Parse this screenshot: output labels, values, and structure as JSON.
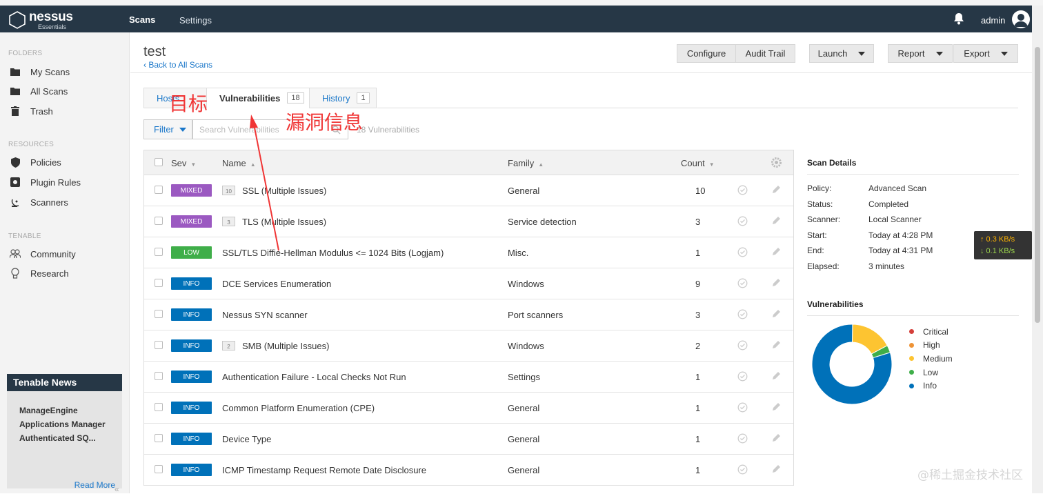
{
  "header": {
    "logo_name": "nessus",
    "logo_sub": "Essentials",
    "nav_scans": "Scans",
    "nav_settings": "Settings",
    "user": "admin"
  },
  "sidebar": {
    "folders_label": "FOLDERS",
    "folders": [
      "My Scans",
      "All Scans",
      "Trash"
    ],
    "resources_label": "RESOURCES",
    "resources": [
      "Policies",
      "Plugin Rules",
      "Scanners"
    ],
    "tenable_label": "TENABLE",
    "tenable": [
      "Community",
      "Research"
    ],
    "news_title": "Tenable News",
    "news_text": "ManageEngine Applications Manager Authenticated SQ...",
    "read_more": "Read More",
    "collapse": "«"
  },
  "page": {
    "title": "test",
    "back_link": "Back to All Scans",
    "configure": "Configure",
    "audit_trail": "Audit Trail",
    "launch": "Launch",
    "report": "Report",
    "export": "Export"
  },
  "tabs": {
    "hosts": "Hosts",
    "vulnerabilities": "Vulnerabilities",
    "vulnerabilities_count": "18",
    "history": "History",
    "history_count": "1"
  },
  "filter": {
    "label": "Filter",
    "search_placeholder": "Search Vulnerabilities",
    "count_text": "18 Vulnerabilities"
  },
  "table": {
    "headers": {
      "sev": "Sev",
      "name": "Name",
      "family": "Family",
      "count": "Count"
    },
    "rows": [
      {
        "sev": "MIXED",
        "folder": "10",
        "name": "SSL (Multiple Issues)",
        "family": "General",
        "count": "10"
      },
      {
        "sev": "MIXED",
        "folder": "3",
        "name": "TLS (Multiple Issues)",
        "family": "Service detection",
        "count": "3"
      },
      {
        "sev": "LOW",
        "folder": "",
        "name": "SSL/TLS Diffie-Hellman Modulus <= 1024 Bits (Logjam)",
        "family": "Misc.",
        "count": "1"
      },
      {
        "sev": "INFO",
        "folder": "",
        "name": "DCE Services Enumeration",
        "family": "Windows",
        "count": "9"
      },
      {
        "sev": "INFO",
        "folder": "",
        "name": "Nessus SYN scanner",
        "family": "Port scanners",
        "count": "3"
      },
      {
        "sev": "INFO",
        "folder": "2",
        "name": "SMB (Multiple Issues)",
        "family": "Windows",
        "count": "2"
      },
      {
        "sev": "INFO",
        "folder": "",
        "name": "Authentication Failure - Local Checks Not Run",
        "family": "Settings",
        "count": "1"
      },
      {
        "sev": "INFO",
        "folder": "",
        "name": "Common Platform Enumeration (CPE)",
        "family": "General",
        "count": "1"
      },
      {
        "sev": "INFO",
        "folder": "",
        "name": "Device Type",
        "family": "General",
        "count": "1"
      },
      {
        "sev": "INFO",
        "folder": "",
        "name": "ICMP Timestamp Request Remote Date Disclosure",
        "family": "General",
        "count": "1"
      }
    ]
  },
  "scan_details": {
    "title": "Scan Details",
    "items": [
      {
        "label": "Policy:",
        "value": "Advanced Scan"
      },
      {
        "label": "Status:",
        "value": "Completed"
      },
      {
        "label": "Scanner:",
        "value": "Local Scanner"
      },
      {
        "label": "Start:",
        "value": "Today at 4:28 PM"
      },
      {
        "label": "End:",
        "value": "Today at 4:31 PM"
      },
      {
        "label": "Elapsed:",
        "value": "3 minutes"
      }
    ]
  },
  "vuln_chart": {
    "title": "Vulnerabilities",
    "legend": [
      {
        "name": "Critical",
        "color": "#d43f3a"
      },
      {
        "name": "High",
        "color": "#ee9336"
      },
      {
        "name": "Medium",
        "color": "#fdc431"
      },
      {
        "name": "Low",
        "color": "#3fae49"
      },
      {
        "name": "Info",
        "color": "#0071b9"
      }
    ],
    "slice_fractions": {
      "Critical": 0,
      "High": 0,
      "Medium": 0.17,
      "Low": 0.03,
      "Info": 0.8
    }
  },
  "speed": {
    "up": "↑ 0.3 KB/s",
    "down": "↓ 0.1 KB/s"
  },
  "annotations": {
    "target": "目标",
    "vuln_info": "漏洞信息"
  },
  "watermark": "@稀土掘金技术社区",
  "colors": {
    "navbar": "#263746",
    "link": "#1a77c9",
    "mixed": "#9b59c1",
    "low": "#3fae49",
    "info": "#0071b9",
    "annotation": "#f03535"
  }
}
